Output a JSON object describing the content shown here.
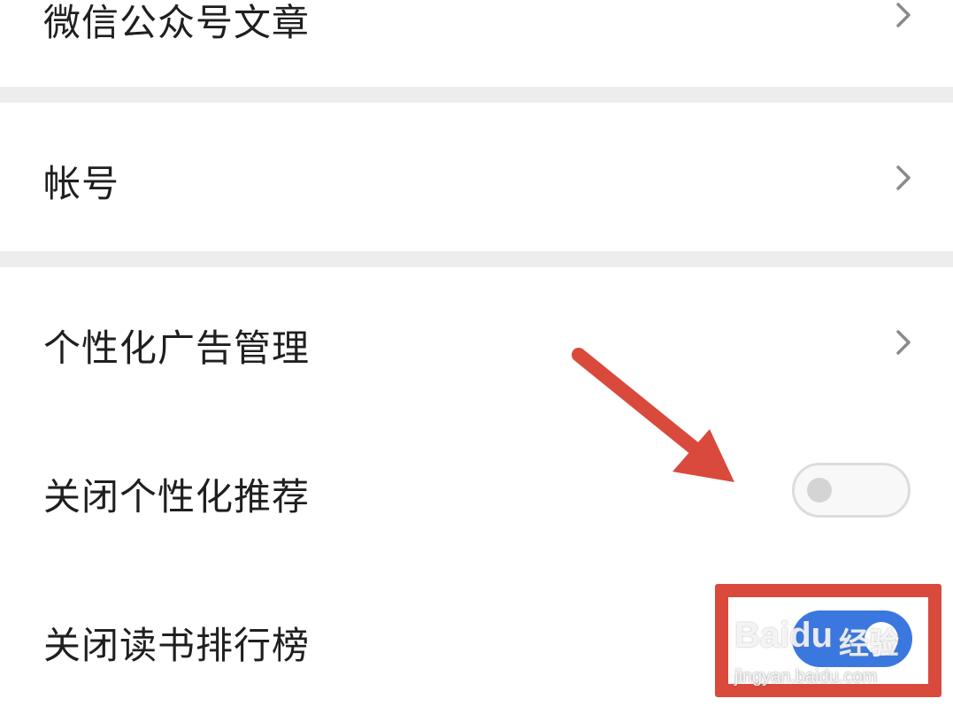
{
  "settings": {
    "items": [
      {
        "label": "微信公众号文章",
        "control": "chevron"
      },
      {
        "label": "帐号",
        "control": "chevron"
      },
      {
        "label": "个性化广告管理",
        "control": "chevron"
      },
      {
        "label": "关闭个性化推荐",
        "control": "toggle",
        "on": false
      },
      {
        "label": "关闭读书排行榜",
        "control": "toggle",
        "on": true
      }
    ]
  },
  "icons": {
    "chevron": "chevron-right-icon",
    "arrow": "red-arrow-annotation"
  },
  "colors": {
    "toggle_on": "#3a78e0",
    "toggle_off": "#f8f8f8",
    "annotation_red": "#d94a3c",
    "separator": "#ededed",
    "text": "#1f1f1f",
    "chevron": "#8a8a8a"
  },
  "watermark": {
    "brand": "Baidu",
    "cn": "经验",
    "url": "jingyan.baidu.com"
  }
}
